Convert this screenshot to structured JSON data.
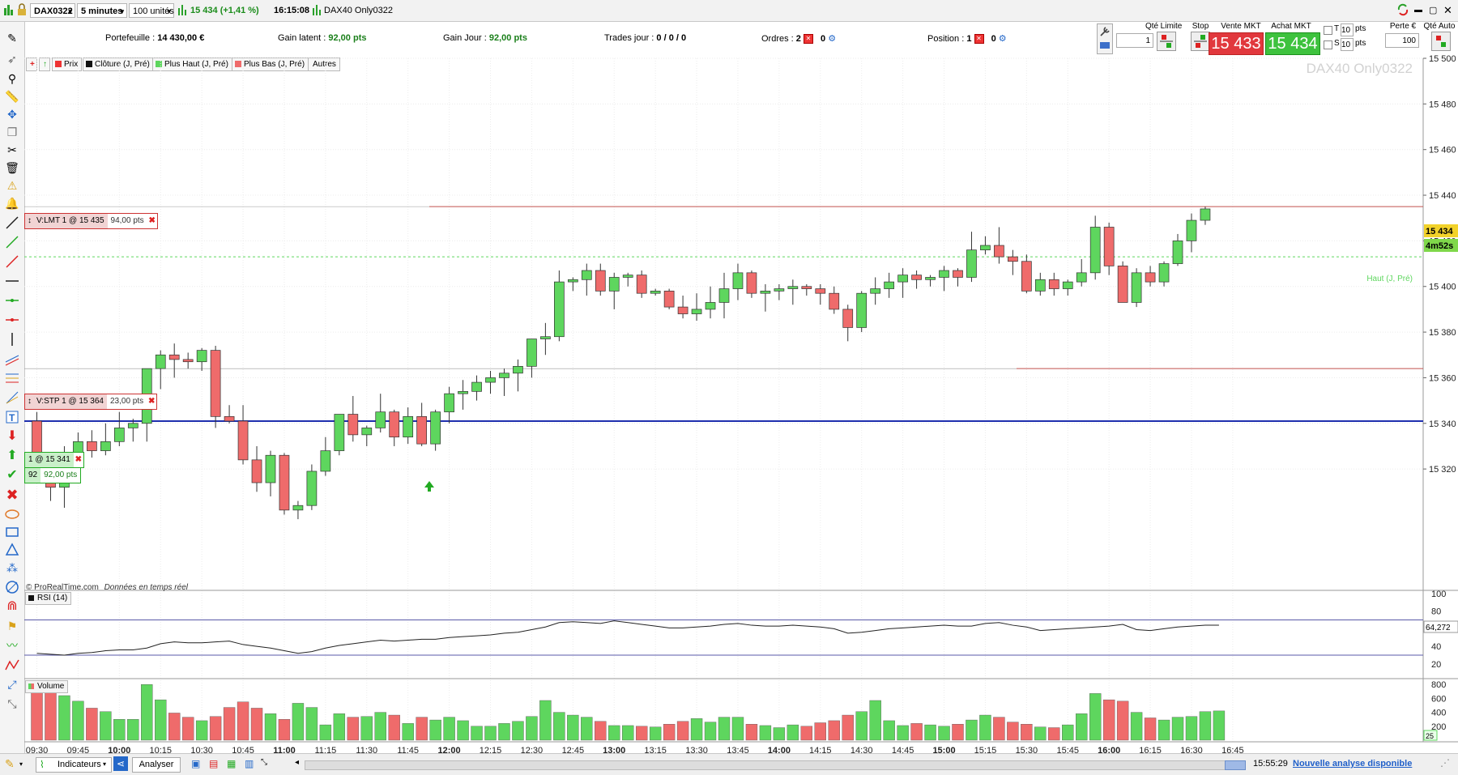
{
  "titlebar": {
    "instrument": "DAX0322",
    "timeframe": "5 minutes",
    "units": "100 unités",
    "quote": "15 434 (+1,41 %)",
    "time": "16:15:08",
    "title": "DAX40 Only0322"
  },
  "infobar": {
    "portefeuille_label": "Portefeuille :",
    "portefeuille_value": "14 430,00 €",
    "gain_latent_label": "Gain latent :",
    "gain_latent_value": "92,00 pts",
    "gain_jour_label": "Gain Jour :",
    "gain_jour_value": "92,00 pts",
    "trades_label": "Trades jour :",
    "trades_value": "0 / 0 / 0",
    "ordres_label": "Ordres :",
    "ordres_value": "2",
    "ordres_value2": "0",
    "position_label": "Position :",
    "position_value": "1",
    "position_value2": "0"
  },
  "trade_panel": {
    "qte_label": "Qté",
    "qte_value": "1",
    "limite_label": "Limite",
    "stop_label": "Stop",
    "vente_label": "Vente MKT",
    "vente_price": "15 433",
    "achat_label": "Achat MKT",
    "achat_price": "15 434",
    "t_label": "T",
    "t_value": "10",
    "t_unit": "pts",
    "s_label": "S",
    "s_value": "10",
    "s_unit": "pts",
    "perte_label": "Perte €",
    "perte_value": "100",
    "qte_auto_label": "Qté Auto"
  },
  "legend": {
    "prix": "Prix",
    "cloture": "Clôture (J, Pré)",
    "plus_haut": "Plus Haut (J, Pré)",
    "plus_bas": "Plus Bas (J, Pré)",
    "autres": "Autres"
  },
  "chart_labels": {
    "watermark": "DAX40 Only0322",
    "haut_label": "Haut (J, Pré)",
    "credit_prefix": "© ProRealTime.com",
    "credit_suffix": "Données en temps réel",
    "price_tag": "15 434",
    "countdown": "4m52s",
    "rsi_title": "RSI (14)",
    "rsi_value": "64,272",
    "volume_title": "Volume",
    "volume_last": "25"
  },
  "orders": {
    "limit_tag": "V:LMT  1 @ 15 435",
    "limit_pts": "94,00 pts",
    "stop_tag": "V:STP  1 @ 15 364",
    "stop_pts": "23,00 pts",
    "position_tag": "1 @ 15 341",
    "position_qty": "92",
    "position_pts": "92,00 pts"
  },
  "bottombar": {
    "indicateurs": "Indicateurs",
    "analyser": "Analyser",
    "time": "15:55:29",
    "link": "Nouvelle analyse disponible"
  },
  "colors": {
    "up": "#5ed65e",
    "down": "#ef6b6b",
    "limit_line": "#c0504d",
    "position_line": "#1f2fae",
    "rsi_band": "#5a5aa8",
    "price_tag_bg": "#f2d22a",
    "countdown_bg": "#7fd84a"
  },
  "chart_data": [
    {
      "type": "candlestick",
      "title": "DAX40 Only0322",
      "timeframe": "5 minutes",
      "ylim": [
        15300,
        15500
      ],
      "y_ticks": [
        15320,
        15340,
        15360,
        15380,
        15400,
        15420,
        15440,
        15460,
        15480,
        15500
      ],
      "x_ticks": [
        "09:30",
        "09:45",
        "10:00",
        "10:15",
        "10:30",
        "10:45",
        "11:00",
        "11:15",
        "11:30",
        "11:45",
        "12:00",
        "12:15",
        "12:30",
        "12:45",
        "13:00",
        "13:15",
        "13:30",
        "13:45",
        "14:00",
        "14:15",
        "14:30",
        "14:45",
        "15:00",
        "15:15",
        "15:30",
        "15:45",
        "16:00",
        "16:15",
        "16:30",
        "16:45"
      ],
      "bold_ticks": [
        "10:00",
        "11:00",
        "12:00",
        "13:00",
        "14:00",
        "15:00",
        "16:00"
      ],
      "levels": {
        "limit_order": 15435,
        "stop_order": 15364,
        "position": 15341,
        "haut_j_pre": 15413
      },
      "candles": [
        [
          15341,
          15345,
          15318,
          15320
        ],
        [
          15320,
          15322,
          15306,
          15312
        ],
        [
          15312,
          15330,
          15303,
          15322
        ],
        [
          15322,
          15336,
          15320,
          15332
        ],
        [
          15332,
          15337,
          15325,
          15328
        ],
        [
          15328,
          15340,
          15326,
          15332
        ],
        [
          15332,
          15345,
          15330,
          15338
        ],
        [
          15338,
          15342,
          15332,
          15340
        ],
        [
          15340,
          15360,
          15332,
          15364
        ],
        [
          15364,
          15372,
          15355,
          15370
        ],
        [
          15370,
          15375,
          15360,
          15368
        ],
        [
          15368,
          15371,
          15364,
          15367
        ],
        [
          15367,
          15373,
          15363,
          15372
        ],
        [
          15372,
          15374,
          15338,
          15343
        ],
        [
          15343,
          15348,
          15340,
          15341
        ],
        [
          15341,
          15348,
          15322,
          15324
        ],
        [
          15324,
          15330,
          15310,
          15314
        ],
        [
          15314,
          15328,
          15308,
          15326
        ],
        [
          15326,
          15327,
          15300,
          15302
        ],
        [
          15302,
          15306,
          15298,
          15304
        ],
        [
          15304,
          15322,
          15302,
          15319
        ],
        [
          15319,
          15334,
          15317,
          15328
        ],
        [
          15328,
          15342,
          15326,
          15344
        ],
        [
          15344,
          15352,
          15332,
          15335
        ],
        [
          15335,
          15339,
          15330,
          15338
        ],
        [
          15338,
          15353,
          15336,
          15345
        ],
        [
          15345,
          15346,
          15330,
          15334
        ],
        [
          15334,
          15347,
          15331,
          15343
        ],
        [
          15343,
          15349,
          15330,
          15331
        ],
        [
          15331,
          15346,
          15328,
          15345
        ],
        [
          15345,
          15356,
          15340,
          15353
        ],
        [
          15353,
          15359,
          15346,
          15354
        ],
        [
          15354,
          15361,
          15350,
          15358
        ],
        [
          15358,
          15363,
          15353,
          15360
        ],
        [
          15360,
          15364,
          15352,
          15362
        ],
        [
          15362,
          15368,
          15354,
          15365
        ],
        [
          15365,
          15376,
          15360,
          15377
        ],
        [
          15377,
          15384,
          15370,
          15378
        ],
        [
          15378,
          15407,
          15376,
          15402
        ],
        [
          15402,
          15404,
          15398,
          15403
        ],
        [
          15403,
          15410,
          15396,
          15407
        ],
        [
          15407,
          15410,
          15396,
          15398
        ],
        [
          15398,
          15406,
          15390,
          15404
        ],
        [
          15404,
          15406,
          15400,
          15405
        ],
        [
          15405,
          15407,
          15395,
          15397
        ],
        [
          15397,
          15399,
          15396,
          15398
        ],
        [
          15398,
          15399,
          15390,
          15391
        ],
        [
          15391,
          15396,
          15386,
          15388
        ],
        [
          15388,
          15397,
          15385,
          15390
        ],
        [
          15390,
          15400,
          15386,
          15393
        ],
        [
          15393,
          15406,
          15386,
          15399
        ],
        [
          15399,
          15410,
          15394,
          15406
        ],
        [
          15406,
          15407,
          15395,
          15397
        ],
        [
          15397,
          15401,
          15389,
          15398
        ],
        [
          15398,
          15401,
          15394,
          15399
        ],
        [
          15399,
          15403,
          15392,
          15400
        ],
        [
          15400,
          15401,
          15396,
          15399
        ],
        [
          15399,
          15401,
          15392,
          15397
        ],
        [
          15397,
          15400,
          15388,
          15390
        ],
        [
          15390,
          15392,
          15376,
          15382
        ],
        [
          15382,
          15398,
          15380,
          15397
        ],
        [
          15397,
          15404,
          15392,
          15399
        ],
        [
          15399,
          15406,
          15395,
          15402
        ],
        [
          15402,
          15408,
          15395,
          15405
        ],
        [
          15405,
          15407,
          15399,
          15403
        ],
        [
          15403,
          15405,
          15400,
          15404
        ],
        [
          15404,
          15409,
          15398,
          15407
        ],
        [
          15407,
          15408,
          15400,
          15404
        ],
        [
          15404,
          15424,
          15402,
          15416
        ],
        [
          15416,
          15422,
          15414,
          15418
        ],
        [
          15418,
          15426,
          15410,
          15413
        ],
        [
          15413,
          15416,
          15405,
          15411
        ],
        [
          15411,
          15414,
          15397,
          15398
        ],
        [
          15398,
          15406,
          15396,
          15403
        ],
        [
          15403,
          15406,
          15396,
          15399
        ],
        [
          15399,
          15403,
          15396,
          15402
        ],
        [
          15402,
          15412,
          15400,
          15406
        ],
        [
          15406,
          15431,
          15403,
          15426
        ],
        [
          15426,
          15428,
          15405,
          15409
        ],
        [
          15409,
          15411,
          15396,
          15393
        ],
        [
          15393,
          15408,
          15391,
          15406
        ],
        [
          15406,
          15409,
          15400,
          15402
        ],
        [
          15402,
          15411,
          15400,
          15410
        ],
        [
          15410,
          15423,
          15409,
          15420
        ],
        [
          15420,
          15432,
          15415,
          15429
        ],
        [
          15429,
          15435,
          15427,
          15434
        ]
      ]
    },
    {
      "type": "line",
      "name": "RSI (14)",
      "ylim": [
        0,
        100
      ],
      "y_ticks": [
        20,
        40,
        60,
        80,
        100
      ],
      "bands": [
        70,
        30
      ],
      "last_value": 64.272,
      "values": [
        32,
        31,
        30,
        32,
        33,
        35,
        36,
        36,
        38,
        43,
        45,
        44,
        44,
        45,
        46,
        42,
        40,
        38,
        35,
        32,
        34,
        38,
        41,
        43,
        45,
        47,
        46,
        47,
        48,
        48,
        50,
        51,
        52,
        53,
        55,
        56,
        59,
        62,
        67,
        68,
        67,
        66,
        69,
        67,
        65,
        63,
        61,
        61,
        62,
        63,
        65,
        66,
        64,
        63,
        63,
        64,
        63,
        62,
        60,
        55,
        56,
        58,
        60,
        61,
        62,
        63,
        64,
        63,
        63,
        66,
        67,
        64,
        62,
        58,
        59,
        60,
        61,
        62,
        63,
        65,
        59,
        58,
        60,
        62,
        63,
        64,
        64
      ]
    },
    {
      "type": "bar",
      "name": "Volume",
      "ylim": [
        0,
        900
      ],
      "y_ticks": [
        200,
        400,
        600,
        800
      ],
      "values": [
        720,
        810,
        640,
        560,
        460,
        410,
        300,
        300,
        800,
        580,
        390,
        330,
        280,
        340,
        470,
        550,
        460,
        380,
        300,
        530,
        470,
        220,
        380,
        330,
        340,
        400,
        360,
        240,
        330,
        290,
        330,
        280,
        200,
        200,
        240,
        270,
        340,
        570,
        400,
        360,
        330,
        270,
        210,
        210,
        200,
        190,
        230,
        270,
        310,
        260,
        330,
        330,
        230,
        210,
        180,
        220,
        200,
        250,
        280,
        360,
        410,
        570,
        280,
        210,
        240,
        220,
        200,
        230,
        290,
        360,
        330,
        260,
        230,
        190,
        180,
        220,
        380,
        670,
        580,
        560,
        400,
        320,
        290,
        330,
        340,
        410,
        420
      ]
    }
  ]
}
